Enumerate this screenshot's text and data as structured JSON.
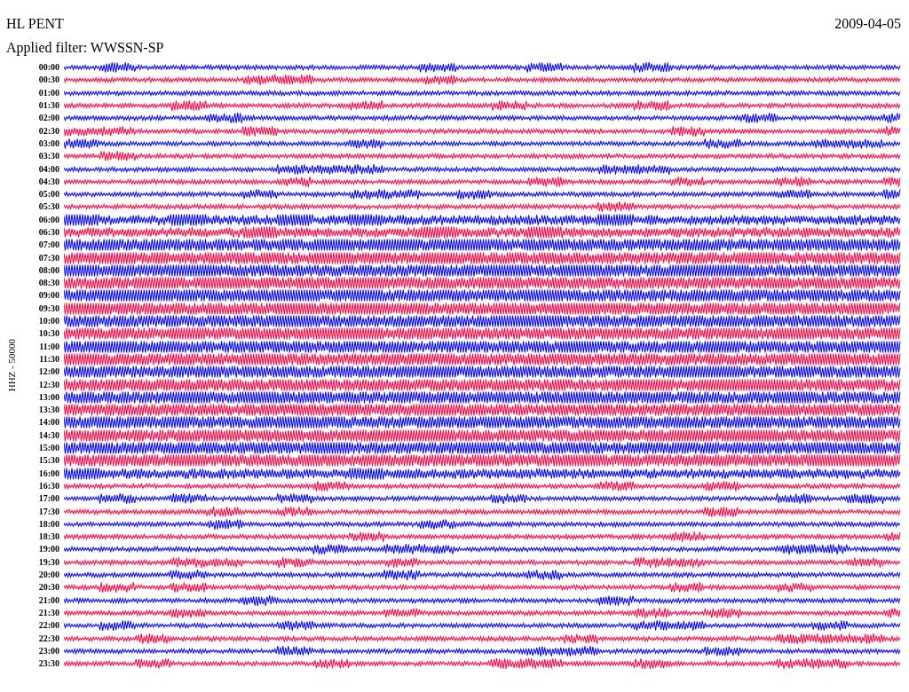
{
  "header": {
    "station": "HL PENT",
    "date": "2009-04-05",
    "filter": "Applied filter: WWSSN-SP"
  },
  "plot": {
    "axis_label": "HHZ - 50000",
    "rows": [
      {
        "time": "00:00",
        "color": "#0000ff"
      },
      {
        "time": "00:30",
        "color": "#ff0040"
      },
      {
        "time": "01:00",
        "color": "#0000ff"
      },
      {
        "time": "01:30",
        "color": "#ff0040"
      },
      {
        "time": "02:00",
        "color": "#0000ff"
      },
      {
        "time": "02:30",
        "color": "#ff0040"
      },
      {
        "time": "03:00",
        "color": "#0000ff"
      },
      {
        "time": "03:30",
        "color": "#ff0040"
      },
      {
        "time": "04:00",
        "color": "#0000ff"
      },
      {
        "time": "04:30",
        "color": "#ff0040"
      },
      {
        "time": "05:00",
        "color": "#0000ff"
      },
      {
        "time": "05:30",
        "color": "#ff0040"
      },
      {
        "time": "06:00",
        "color": "#0000ff"
      },
      {
        "time": "06:30",
        "color": "#ff0040"
      },
      {
        "time": "07:00",
        "color": "#0000ff"
      },
      {
        "time": "07:30",
        "color": "#ff0040"
      },
      {
        "time": "08:00",
        "color": "#0000ff"
      },
      {
        "time": "08:30",
        "color": "#ff0040"
      },
      {
        "time": "09:00",
        "color": "#0000ff"
      },
      {
        "time": "09:30",
        "color": "#ff0040"
      },
      {
        "time": "10:00",
        "color": "#0000ff"
      },
      {
        "time": "10:30",
        "color": "#ff0040"
      },
      {
        "time": "11:00",
        "color": "#0000ff"
      },
      {
        "time": "11:30",
        "color": "#ff0040"
      },
      {
        "time": "12:00",
        "color": "#0000ff"
      },
      {
        "time": "12:30",
        "color": "#ff0040"
      },
      {
        "time": "13:00",
        "color": "#0000ff"
      },
      {
        "time": "13:30",
        "color": "#ff0040"
      },
      {
        "time": "14:00",
        "color": "#0000ff"
      },
      {
        "time": "14:30",
        "color": "#ff0040"
      },
      {
        "time": "15:00",
        "color": "#0000ff"
      },
      {
        "time": "15:30",
        "color": "#ff0040"
      },
      {
        "time": "16:00",
        "color": "#0000ff"
      },
      {
        "time": "16:30",
        "color": "#ff0040"
      },
      {
        "time": "17:00",
        "color": "#0000ff"
      },
      {
        "time": "17:30",
        "color": "#ff0040"
      },
      {
        "time": "18:00",
        "color": "#0000ff"
      },
      {
        "time": "18:30",
        "color": "#ff0040"
      },
      {
        "time": "19:00",
        "color": "#0000ff"
      },
      {
        "time": "19:30",
        "color": "#ff0040"
      },
      {
        "time": "20:00",
        "color": "#0000ff"
      },
      {
        "time": "20:30",
        "color": "#ff0040"
      },
      {
        "time": "21:00",
        "color": "#0000ff"
      },
      {
        "time": "21:30",
        "color": "#ff0040"
      },
      {
        "time": "22:00",
        "color": "#0000ff"
      },
      {
        "time": "22:30",
        "color": "#ff0040"
      },
      {
        "time": "23:00",
        "color": "#0000ff"
      },
      {
        "time": "23:30",
        "color": "#ff0040"
      }
    ]
  }
}
